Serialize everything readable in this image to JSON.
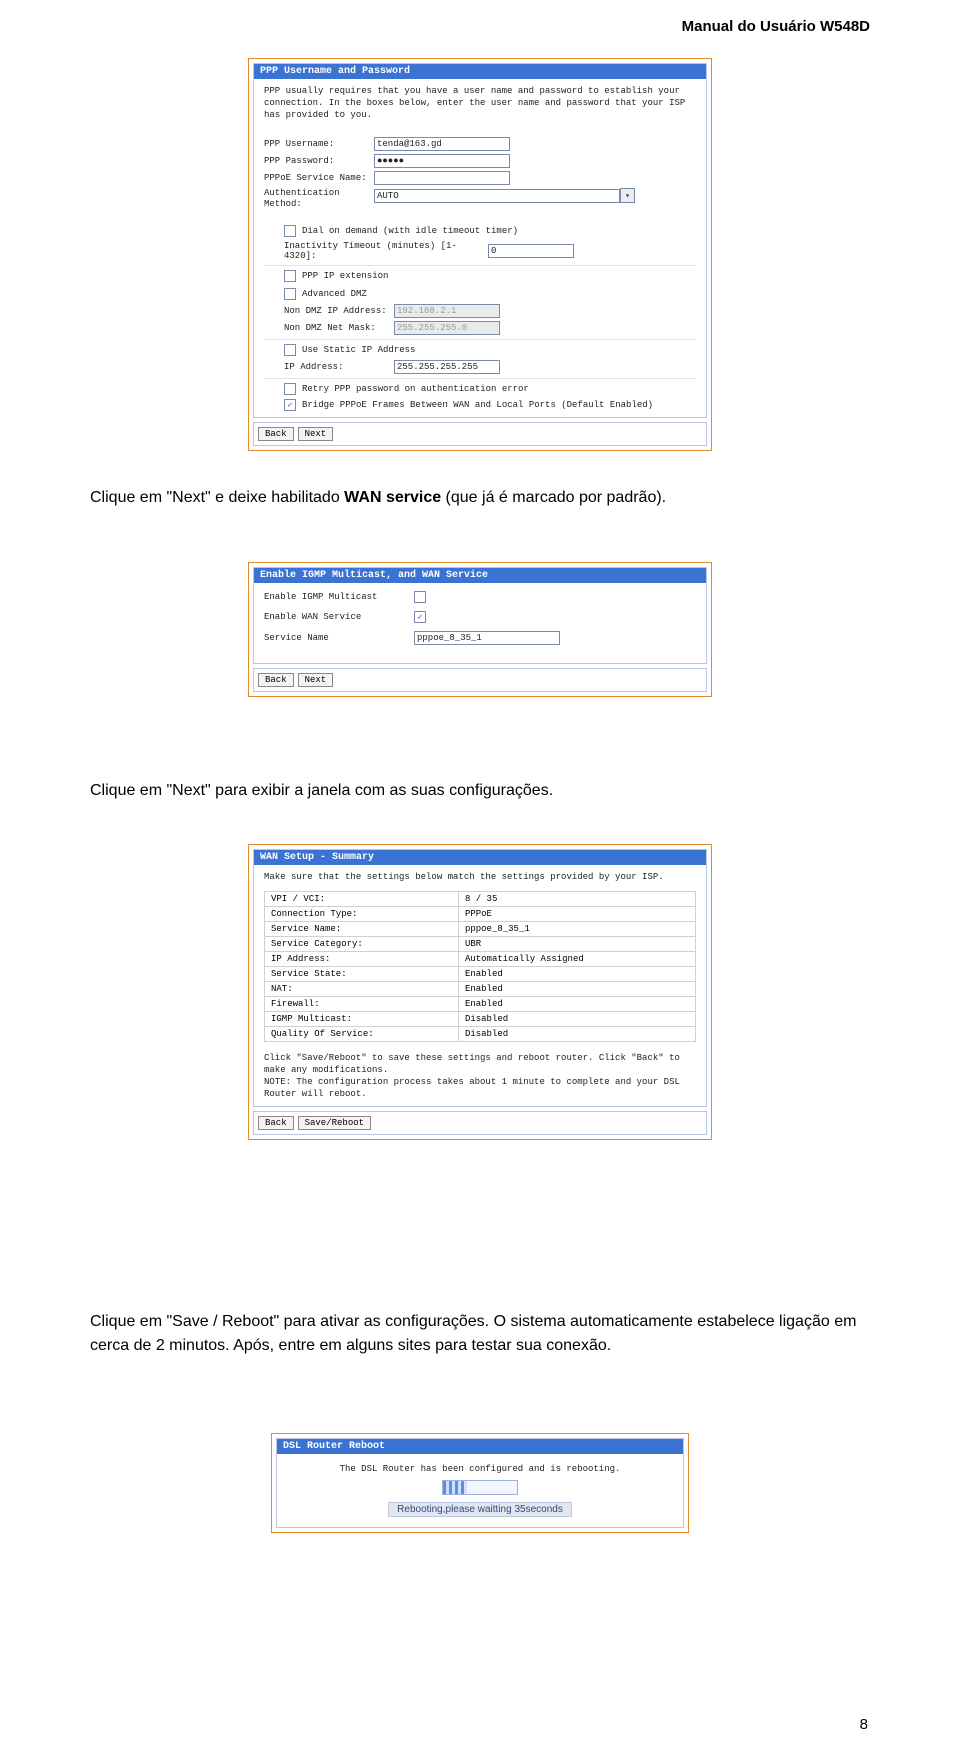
{
  "header": {
    "title": "Manual do Usuário W548D"
  },
  "body": {
    "p1_prefix": "Clique em \"Next\" e deixe habilitado ",
    "p1_bold": "WAN service",
    "p1_suffix": " (que já é marcado por padrão).",
    "p2": "Clique em \"Next\" para exibir a janela com as suas configurações.",
    "p3": "Clique em \"Save / Reboot\" para ativar as configurações. O sistema automaticamente estabelece ligação em cerca de 2 minutos. Após, entre em alguns sites para testar sua conexão."
  },
  "page_number": "8",
  "panel1": {
    "title": "PPP Username and Password",
    "intro": "PPP usually requires that you have a user name and password to establish your connection. In the boxes below, enter the user name and password that your ISP has provided to you.",
    "fields": {
      "ppp_username_label": "PPP Username:",
      "ppp_username_value": "tenda@163.gd",
      "ppp_password_label": "PPP Password:",
      "ppp_password_value": "●●●●●",
      "pppoe_service_name_label": "PPPoE Service Name:",
      "auth_method_label": "Authentication Method:",
      "auth_method_value": "AUTO",
      "dial_on_demand_label": "Dial on demand (with idle timeout timer)",
      "inactivity_label": "Inactivity Timeout (minutes) [1-4320]:",
      "inactivity_value": "0",
      "ppp_ip_ext_label": "PPP IP extension",
      "advanced_dmz_label": "Advanced DMZ",
      "non_dmz_ip_label": "Non DMZ IP Address:",
      "non_dmz_ip_value": "192.168.2.1",
      "non_dmz_mask_label": "Non DMZ Net Mask:",
      "non_dmz_mask_value": "255.255.255.0",
      "use_static_ip_label": "Use Static IP Address",
      "ip_address_label": "IP Address:",
      "ip_address_value": "255.255.255.255",
      "retry_ppp_label": "Retry PPP password on authentication error",
      "bridge_pppoe_label": "Bridge PPPoE Frames Between WAN and Local Ports (Default Enabled)"
    },
    "buttons": {
      "back": "Back",
      "next": "Next"
    }
  },
  "panel2": {
    "title": "Enable IGMP Multicast, and WAN Service",
    "fields": {
      "igmp_label": "Enable IGMP Multicast",
      "wan_label": "Enable WAN Service",
      "service_name_label": "Service Name",
      "service_name_value": "pppoe_8_35_1"
    },
    "buttons": {
      "back": "Back",
      "next": "Next"
    }
  },
  "panel3": {
    "title": "WAN Setup - Summary",
    "intro": "Make sure that the settings below match the settings provided by your ISP.",
    "rows": [
      {
        "k": "VPI / VCI:",
        "v": "8 / 35"
      },
      {
        "k": "Connection Type:",
        "v": "PPPoE"
      },
      {
        "k": "Service Name:",
        "v": "pppoe_8_35_1"
      },
      {
        "k": "Service Category:",
        "v": "UBR"
      },
      {
        "k": "IP Address:",
        "v": "Automatically Assigned"
      },
      {
        "k": "Service State:",
        "v": "Enabled"
      },
      {
        "k": "NAT:",
        "v": "Enabled"
      },
      {
        "k": "Firewall:",
        "v": "Enabled"
      },
      {
        "k": "IGMP Multicast:",
        "v": "Disabled"
      },
      {
        "k": "Quality Of Service:",
        "v": "Disabled"
      }
    ],
    "note": "Click \"Save/Reboot\" to save these settings and reboot router. Click \"Back\" to make any modifications.\nNOTE: The configuration process takes about 1 minute to complete and your DSL Router will reboot.",
    "buttons": {
      "back": "Back",
      "save": "Save/Reboot"
    }
  },
  "panel4": {
    "title": "DSL Router Reboot",
    "msg": "The DSL Router has been configured and is rebooting.",
    "progress_label": "Rebooting,please waitting 35seconds"
  }
}
